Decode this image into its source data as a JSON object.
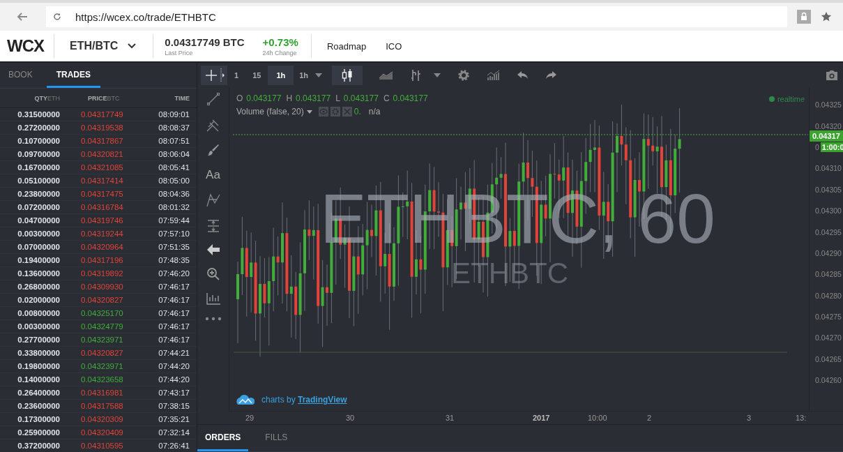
{
  "browser": {
    "url": "https://wcex.co/trade/ETHBTC"
  },
  "header": {
    "logo": "WCX",
    "pair": "ETH/BTC",
    "last_price": "0.04317749 BTC",
    "last_price_label": "Last Price",
    "change": "+0.73%",
    "change_label": "24h Change",
    "nav": [
      "Roadmap",
      "ICO"
    ]
  },
  "side_tabs": [
    {
      "label": "BOOK",
      "selected": false
    },
    {
      "label": "TRADES",
      "selected": true
    }
  ],
  "trades": {
    "columns": [
      {
        "label": "QTY",
        "unit": "ETH"
      },
      {
        "label": "PRICE",
        "unit": "BTC"
      },
      {
        "label": "TIME"
      }
    ],
    "rows": [
      {
        "qty": "0.31500000",
        "price": "0.04317749",
        "color": "#e0443a",
        "time": "08:09:01"
      },
      {
        "qty": "0.27200000",
        "price": "0.04319538",
        "color": "#e0443a",
        "time": "08:08:37"
      },
      {
        "qty": "0.10700000",
        "price": "0.04317867",
        "color": "#e0443a",
        "time": "08:07:51"
      },
      {
        "qty": "0.09700000",
        "price": "0.04320821",
        "color": "#e0443a",
        "time": "08:06:04"
      },
      {
        "qty": "0.16700000",
        "price": "0.04321085",
        "color": "#e0443a",
        "time": "08:05:41"
      },
      {
        "qty": "0.05100000",
        "price": "0.04317414",
        "color": "#e0443a",
        "time": "08:05:00"
      },
      {
        "qty": "0.23800000",
        "price": "0.04317475",
        "color": "#e0443a",
        "time": "08:04:36"
      },
      {
        "qty": "0.07200000",
        "price": "0.04316784",
        "color": "#e0443a",
        "time": "08:01:32"
      },
      {
        "qty": "0.04700000",
        "price": "0.04319746",
        "color": "#e0443a",
        "time": "07:59:44"
      },
      {
        "qty": "0.00300000",
        "price": "0.04319244",
        "color": "#e0443a",
        "time": "07:57:10"
      },
      {
        "qty": "0.07000000",
        "price": "0.04320964",
        "color": "#e0443a",
        "time": "07:51:35"
      },
      {
        "qty": "0.19400000",
        "price": "0.04317196",
        "color": "#e0443a",
        "time": "07:48:35"
      },
      {
        "qty": "0.13600000",
        "price": "0.04319892",
        "color": "#e0443a",
        "time": "07:46:20"
      },
      {
        "qty": "0.26800000",
        "price": "0.04309930",
        "color": "#e0443a",
        "time": "07:46:17"
      },
      {
        "qty": "0.02000000",
        "price": "0.04320827",
        "color": "#e0443a",
        "time": "07:46:17"
      },
      {
        "qty": "0.00800000",
        "price": "0.04325170",
        "color": "#43ad3c",
        "time": "07:46:17"
      },
      {
        "qty": "0.00300000",
        "price": "0.04324779",
        "color": "#43ad3c",
        "time": "07:46:17"
      },
      {
        "qty": "0.27700000",
        "price": "0.04323971",
        "color": "#43ad3c",
        "time": "07:46:17"
      },
      {
        "qty": "0.33800000",
        "price": "0.04320827",
        "color": "#e0443a",
        "time": "07:44:21"
      },
      {
        "qty": "0.19800000",
        "price": "0.04323971",
        "color": "#43ad3c",
        "time": "07:44:20"
      },
      {
        "qty": "0.14000000",
        "price": "0.04323658",
        "color": "#43ad3c",
        "time": "07:44:20"
      },
      {
        "qty": "0.26400000",
        "price": "0.04316981",
        "color": "#e0443a",
        "time": "07:43:17"
      },
      {
        "qty": "0.23600000",
        "price": "0.04317588",
        "color": "#e0443a",
        "time": "07:38:15"
      },
      {
        "qty": "0.17300000",
        "price": "0.04320309",
        "color": "#e0443a",
        "time": "07:35:21"
      },
      {
        "qty": "0.25900000",
        "price": "0.04320409",
        "color": "#e0443a",
        "time": "07:32:14"
      },
      {
        "qty": "0.37200000",
        "price": "0.04310595",
        "color": "#e0443a",
        "time": "07:26:41"
      }
    ]
  },
  "chart": {
    "intervals": [
      {
        "label": "1",
        "selected": false
      },
      {
        "label": "15",
        "selected": false
      },
      {
        "label": "1h",
        "selected": true
      }
    ],
    "interval_menu": "1h",
    "text_tool": "Aa",
    "ohlc": [
      {
        "label": "O",
        "value": "0.043177"
      },
      {
        "label": "H",
        "value": "0.043177"
      },
      {
        "label": "L",
        "value": "0.043177"
      },
      {
        "label": "C",
        "value": "0.043177"
      }
    ],
    "volume": {
      "label": "Volume (false, 20)",
      "value": "0.",
      "reading": "n/a"
    },
    "status": "realtime",
    "watermark": "ETHBTC, 60",
    "watermark_sub": "ETHBTC",
    "price_ticks": [
      "0.04325",
      "0.04320",
      "0",
      "0.04310",
      "0.04305",
      "0.04300",
      "0.04295",
      "0.04290",
      "0.04285",
      "0.04280",
      "0.04275",
      "0.04270",
      "0.04265",
      "0.04260"
    ],
    "price_tag": "0.04317",
    "countdown": "1:00:0",
    "time_ticks": [
      {
        "label": "29",
        "bold": false
      },
      {
        "label": "30",
        "bold": false
      },
      {
        "label": "31",
        "bold": false
      },
      {
        "label": "2017",
        "bold": true
      },
      {
        "label": "10:00",
        "bold": false
      },
      {
        "label": "2",
        "bold": false
      },
      {
        "label": "3",
        "bold": false
      },
      {
        "label": "13:",
        "bold": false
      }
    ],
    "credit": {
      "prefix": "charts by",
      "link": "TradingView"
    }
  },
  "bottom_tabs": [
    {
      "label": "ORDERS",
      "selected": true
    },
    {
      "label": "FILLS",
      "selected": false
    }
  ]
}
